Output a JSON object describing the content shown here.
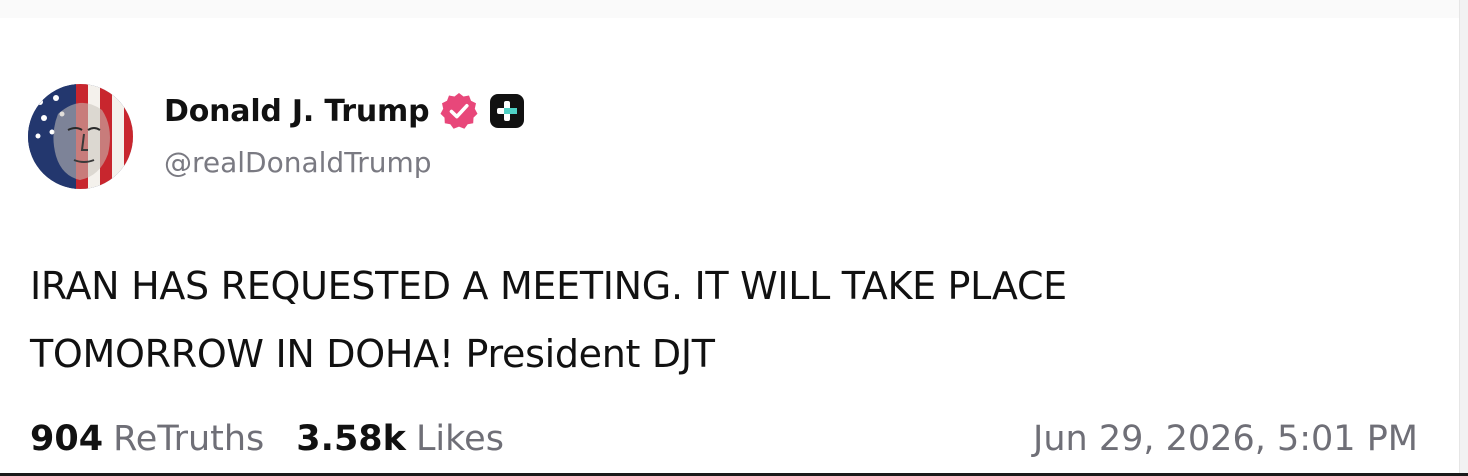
{
  "post": {
    "author": {
      "display_name": "Donald J. Trump",
      "handle": "@realDonaldTrump",
      "avatar_icon": "flag-portrait-avatar",
      "verified_icon": "verified-badge-icon",
      "verified_color": "#e8477a",
      "plus_icon": "plus-badge-icon",
      "plus_color": "#111111"
    },
    "text_line1": "IRAN HAS REQUESTED A MEETING. IT WILL TAKE PLACE",
    "text_line2": "TOMORROW IN DOHA! President DJT",
    "stats": {
      "retruths_count": "904",
      "retruths_label": "ReTruths",
      "likes_count": "3.58k",
      "likes_label": "Likes"
    },
    "timestamp": "Jun 29, 2026, 5:01 PM"
  }
}
